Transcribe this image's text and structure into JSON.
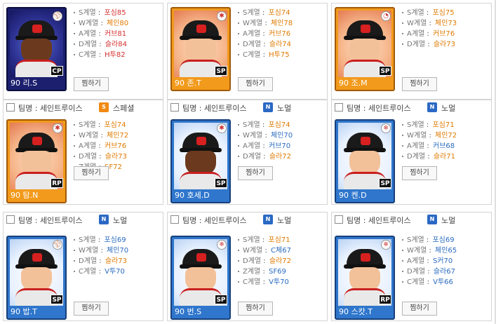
{
  "cells": [
    {
      "header": null,
      "player": {
        "name": "90 리.S",
        "pos": "CP",
        "card_color": "dark",
        "medal": "⚾",
        "skin": "dark"
      },
      "stats": [
        {
          "label": "S계열",
          "value": "포심85",
          "color": "red"
        },
        {
          "label": "W계열",
          "value": "체인80",
          "color": "orange"
        },
        {
          "label": "A계열",
          "value": "커브81",
          "color": "red"
        },
        {
          "label": "D계열",
          "value": "슬라84",
          "color": "red"
        },
        {
          "label": "C계열",
          "value": "H투82",
          "color": "red"
        }
      ],
      "button": "찜하기"
    },
    {
      "header": null,
      "player": {
        "name": "90 존.T",
        "pos": "SP",
        "card_color": "orange",
        "medal": "✱",
        "skin": "light"
      },
      "stats": [
        {
          "label": "S계열",
          "value": "포심74",
          "color": "orange"
        },
        {
          "label": "W계열",
          "value": "체인78",
          "color": "orange"
        },
        {
          "label": "A계열",
          "value": "커브76",
          "color": "orange"
        },
        {
          "label": "D계열",
          "value": "슬라74",
          "color": "orange"
        },
        {
          "label": "C계열",
          "value": "H투75",
          "color": "orange"
        }
      ],
      "button": "찜하기"
    },
    {
      "header": null,
      "player": {
        "name": "90 조.M",
        "pos": "SP",
        "card_color": "orange",
        "medal": "◔",
        "skin": "light"
      },
      "stats": [
        {
          "label": "S계열",
          "value": "포심75",
          "color": "orange"
        },
        {
          "label": "W계열",
          "value": "체인73",
          "color": "orange"
        },
        {
          "label": "A계열",
          "value": "커브76",
          "color": "orange"
        },
        {
          "label": "D계열",
          "value": "슬라73",
          "color": "orange"
        }
      ],
      "button": "찜하기"
    },
    {
      "header": {
        "team": "팀명 : 세인트루이스",
        "badge": "S",
        "badge_type": "special",
        "type_name": "스페셜"
      },
      "player": {
        "name": "90 탐.N",
        "pos": "RP",
        "card_color": "orange",
        "medal": "✱",
        "skin": "light"
      },
      "stats": [
        {
          "label": "S계열",
          "value": "포심74",
          "color": "orange"
        },
        {
          "label": "W계열",
          "value": "체인72",
          "color": "orange"
        },
        {
          "label": "A계열",
          "value": "커브76",
          "color": "orange"
        },
        {
          "label": "D계열",
          "value": "슬라73",
          "color": "orange"
        },
        {
          "label": "Z계열",
          "value": "SF72",
          "color": "orange"
        }
      ],
      "button": "찜하기"
    },
    {
      "header": {
        "team": "팀명 : 세인트루이스",
        "badge": "N",
        "badge_type": "normal",
        "type_name": "노멀"
      },
      "player": {
        "name": "90 호세.D",
        "pos": "SP",
        "card_color": "blue",
        "medal": "✱",
        "skin": "dark"
      },
      "stats": [
        {
          "label": "S계열",
          "value": "포심74",
          "color": "orange"
        },
        {
          "label": "W계열",
          "value": "체인70",
          "color": "blue"
        },
        {
          "label": "A계열",
          "value": "커브70",
          "color": "blue"
        },
        {
          "label": "D계열",
          "value": "슬라72",
          "color": "orange"
        }
      ],
      "button": "찜하기"
    },
    {
      "header": {
        "team": "팀명 : 세인트루이스",
        "badge": "N",
        "badge_type": "normal",
        "type_name": "노멀"
      },
      "player": {
        "name": "90 켄.D",
        "pos": "SP",
        "card_color": "blue",
        "medal": "❄",
        "skin": "light"
      },
      "stats": [
        {
          "label": "S계열",
          "value": "포심71",
          "color": "orange"
        },
        {
          "label": "W계열",
          "value": "체인72",
          "color": "orange"
        },
        {
          "label": "A계열",
          "value": "커브68",
          "color": "blue"
        },
        {
          "label": "D계열",
          "value": "슬라71",
          "color": "orange"
        }
      ],
      "button": "찜하기"
    },
    {
      "header": {
        "team": "팀명 : 세인트루이스",
        "badge": "N",
        "badge_type": "normal",
        "type_name": "노멀"
      },
      "player": {
        "name": "90 밥.T",
        "pos": "SP",
        "card_color": "blue",
        "medal": "⚾",
        "skin": "light"
      },
      "stats": [
        {
          "label": "S계열",
          "value": "포심69",
          "color": "blue"
        },
        {
          "label": "W계열",
          "value": "체인70",
          "color": "blue"
        },
        {
          "label": "D계열",
          "value": "슬라73",
          "color": "orange"
        },
        {
          "label": "C계열",
          "value": "V투70",
          "color": "blue"
        }
      ],
      "button": "찜하기"
    },
    {
      "header": {
        "team": "팀명 : 세인트루이스",
        "badge": "N",
        "badge_type": "normal",
        "type_name": "노멀"
      },
      "player": {
        "name": "90 번.S",
        "pos": "SP",
        "card_color": "blue",
        "medal": "❄",
        "skin": "light"
      },
      "stats": [
        {
          "label": "S계열",
          "value": "포심71",
          "color": "orange"
        },
        {
          "label": "W계열",
          "value": "C체67",
          "color": "blue"
        },
        {
          "label": "D계열",
          "value": "슬라72",
          "color": "orange"
        },
        {
          "label": "Z계열",
          "value": "SF69",
          "color": "blue"
        },
        {
          "label": "C계열",
          "value": "V투70",
          "color": "blue"
        }
      ],
      "button": "찜하기"
    },
    {
      "header": {
        "team": "팀명 : 세인트루이스",
        "badge": "N",
        "badge_type": "normal",
        "type_name": "노멀"
      },
      "player": {
        "name": "90 스캇.T",
        "pos": "RP",
        "card_color": "blue",
        "medal": "❄",
        "skin": "light"
      },
      "stats": [
        {
          "label": "S계열",
          "value": "포심69",
          "color": "blue"
        },
        {
          "label": "W계열",
          "value": "체인65",
          "color": "blue"
        },
        {
          "label": "A계열",
          "value": "S커70",
          "color": "blue"
        },
        {
          "label": "D계열",
          "value": "슬라67",
          "color": "blue"
        },
        {
          "label": "C계열",
          "value": "V투66",
          "color": "blue"
        }
      ],
      "button": "찜하기"
    }
  ]
}
